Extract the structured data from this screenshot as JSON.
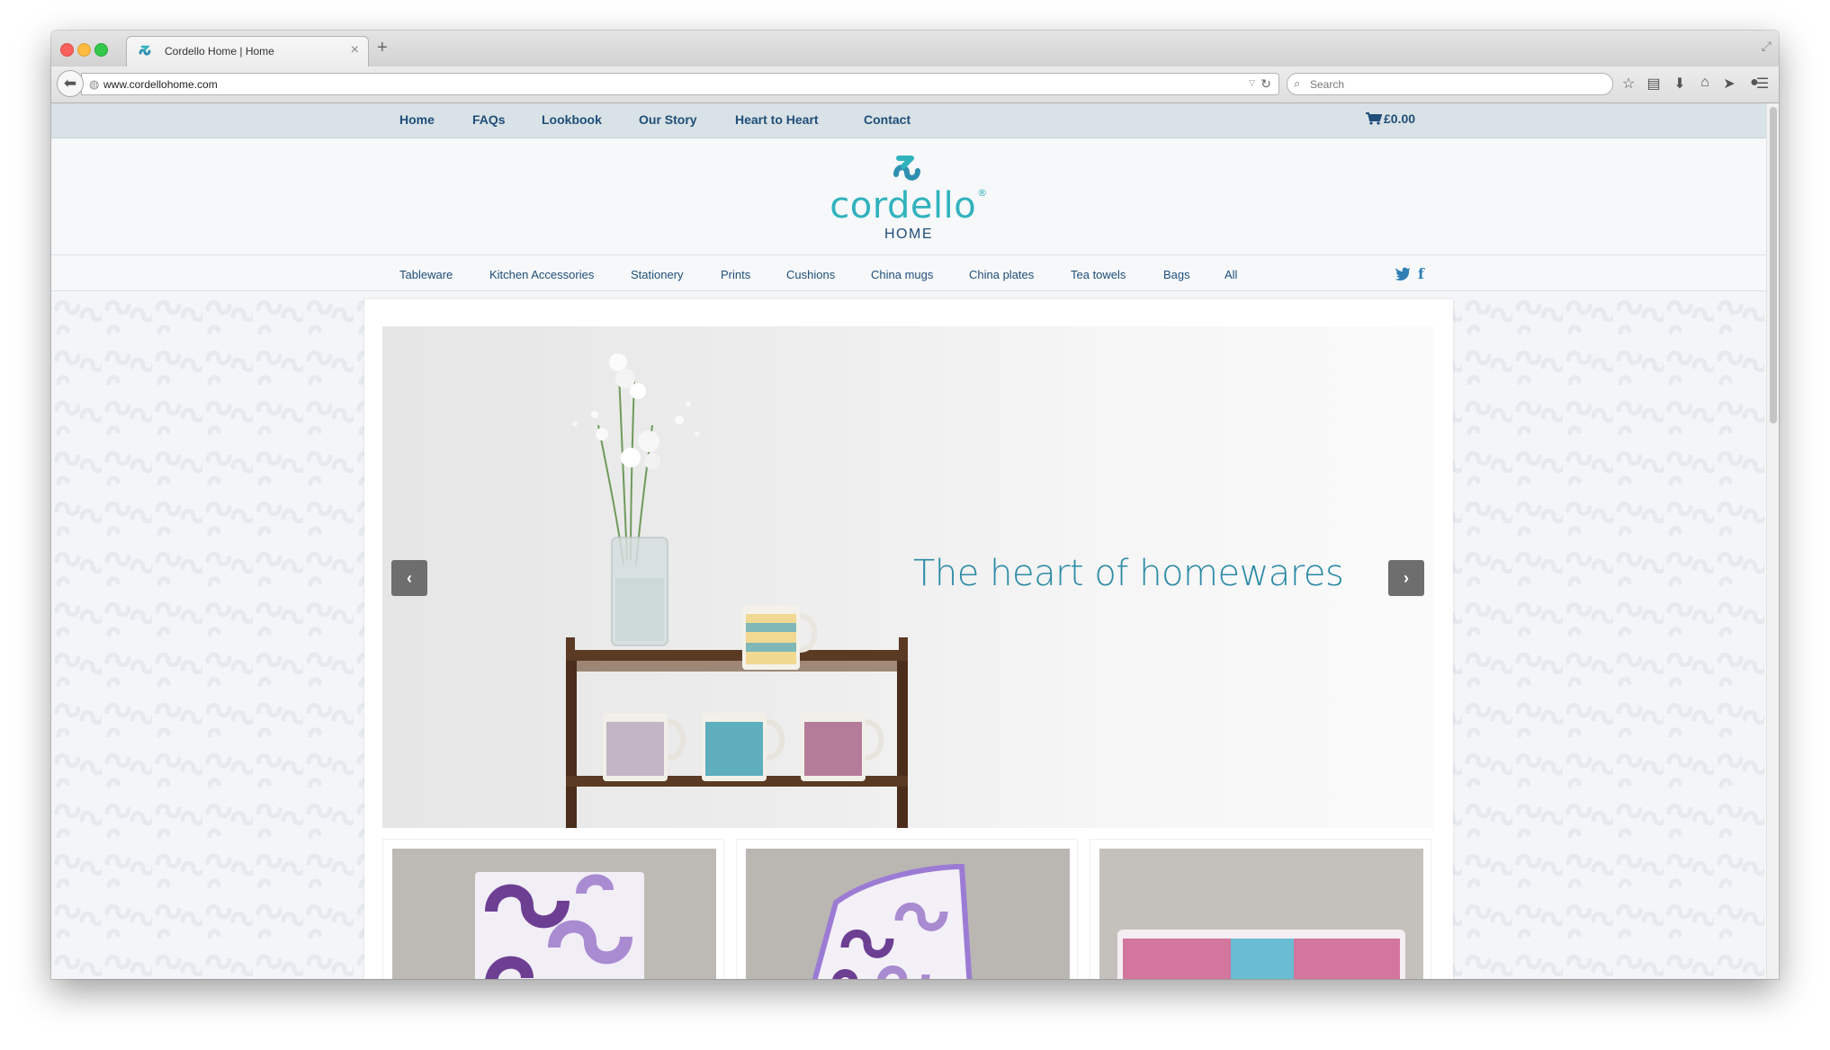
{
  "browser": {
    "tab_title": "Cordello Home | Home",
    "tab_close": "×",
    "new_tab": "+",
    "url": "www.cordellohome.com",
    "search_placeholder": "Search"
  },
  "topnav": {
    "links": [
      "Home",
      "FAQs",
      "Lookbook",
      "Our Story",
      "Heart to Heart",
      "Contact"
    ],
    "cart_total": "£0.00"
  },
  "logo": {
    "word": "cordello",
    "registered": "®",
    "sub": "HOME"
  },
  "categories": [
    "Tableware",
    "Kitchen Accessories",
    "Stationery",
    "Prints",
    "Cushions",
    "China mugs",
    "China plates",
    "Tea towels",
    "Bags",
    "All"
  ],
  "social": {
    "twitter_icon": "twitter-icon",
    "facebook_glyph": "f"
  },
  "slider": {
    "caption": "The heart of homewares",
    "prev_glyph": "‹",
    "next_glyph": "›"
  },
  "colors": {
    "brand_teal": "#30b2bd",
    "nav_blue": "#1f4e79",
    "topnav_bg": "#d9e2e6",
    "caption": "#2a8aa6"
  }
}
